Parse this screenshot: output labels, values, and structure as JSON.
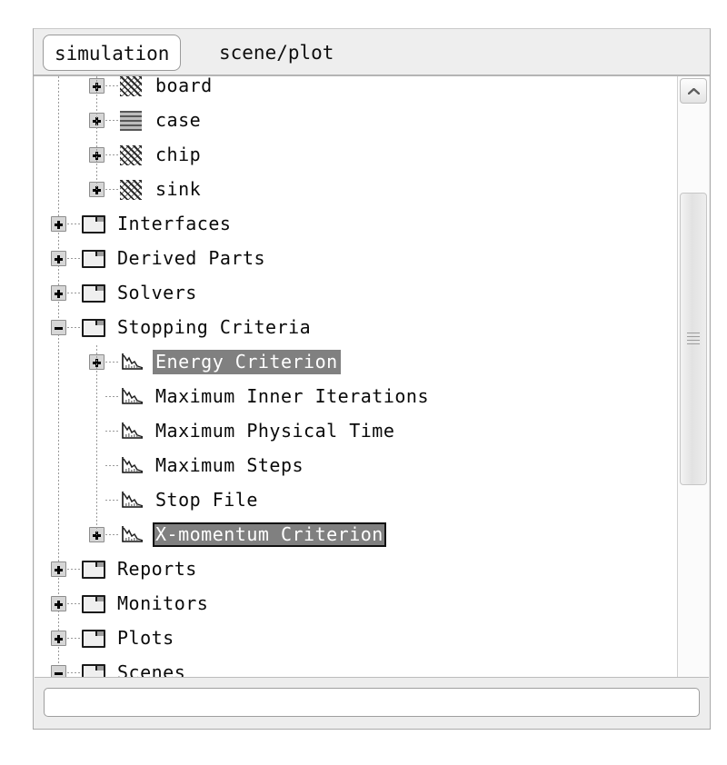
{
  "tabs": [
    {
      "label": "simulation",
      "active": true
    },
    {
      "label": "scene/plot",
      "active": false
    }
  ],
  "tree": {
    "rows": [
      {
        "label": "board",
        "icon": "region-hatch-icon",
        "indent": 2,
        "toggle": "plus",
        "state": "normal",
        "partial_top": true
      },
      {
        "label": "case",
        "icon": "region-blur-icon",
        "indent": 2,
        "toggle": "plus",
        "state": "normal"
      },
      {
        "label": "chip",
        "icon": "region-hatch-icon",
        "indent": 2,
        "toggle": "plus",
        "state": "normal"
      },
      {
        "label": "sink",
        "icon": "region-hatch-icon",
        "indent": 2,
        "toggle": "plus",
        "state": "normal"
      },
      {
        "label": "Interfaces",
        "icon": "folder-icon",
        "indent": 1,
        "toggle": "plus",
        "state": "normal"
      },
      {
        "label": "Derived Parts",
        "icon": "folder-icon",
        "indent": 1,
        "toggle": "plus",
        "state": "normal"
      },
      {
        "label": "Solvers",
        "icon": "folder-icon",
        "indent": 1,
        "toggle": "plus",
        "state": "normal"
      },
      {
        "label": "Stopping Criteria",
        "icon": "folder-icon",
        "indent": 1,
        "toggle": "minus",
        "state": "normal"
      },
      {
        "label": "Energy Criterion",
        "icon": "criterion-plot-icon",
        "indent": 2,
        "toggle": "plus",
        "state": "selected"
      },
      {
        "label": "Maximum Inner Iterations",
        "icon": "criterion-plot-icon",
        "indent": 2,
        "toggle": "none",
        "state": "normal"
      },
      {
        "label": "Maximum Physical Time",
        "icon": "criterion-plot-icon",
        "indent": 2,
        "toggle": "none",
        "state": "normal"
      },
      {
        "label": "Maximum Steps",
        "icon": "criterion-plot-icon",
        "indent": 2,
        "toggle": "none",
        "state": "normal"
      },
      {
        "label": "Stop File",
        "icon": "criterion-plot-icon",
        "indent": 2,
        "toggle": "none",
        "state": "normal"
      },
      {
        "label": "X-momentum Criterion",
        "icon": "criterion-plot-icon",
        "indent": 2,
        "toggle": "plus",
        "state": "focused"
      },
      {
        "label": "Reports",
        "icon": "folder-icon",
        "indent": 1,
        "toggle": "plus",
        "state": "normal"
      },
      {
        "label": "Monitors",
        "icon": "folder-icon",
        "indent": 1,
        "toggle": "plus",
        "state": "normal"
      },
      {
        "label": "Plots",
        "icon": "folder-icon",
        "indent": 1,
        "toggle": "plus",
        "state": "normal"
      },
      {
        "label": "Scenes",
        "icon": "folder-icon",
        "indent": 1,
        "toggle": "minus",
        "state": "normal"
      },
      {
        "label": "",
        "icon": "folder-icon",
        "indent": 2,
        "toggle": "none",
        "state": "normal",
        "partial_bottom": true
      }
    ]
  },
  "scrollbar": {
    "up_arrow": "chevron-up-icon",
    "down_arrow": "chevron-down-icon",
    "grip": "scrollbar-grip-icon"
  },
  "bottom_field": {
    "value": "",
    "placeholder": ""
  },
  "colors": {
    "selection": "#808080",
    "selection_text": "#ffffff",
    "panel_bg": "#eeeeee",
    "tree_bg": "#ffffff",
    "focus_border": "#111111"
  }
}
